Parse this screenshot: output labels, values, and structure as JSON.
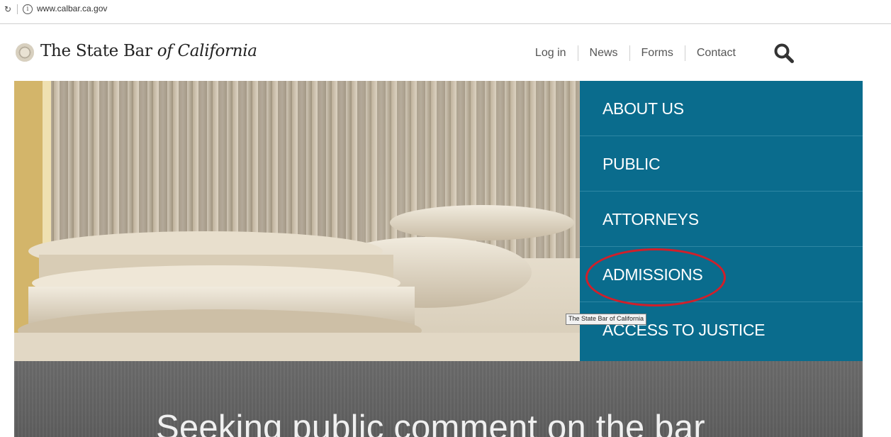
{
  "browser": {
    "reload_glyph": "↻",
    "info_glyph": "i",
    "url": "www.calbar.ca.gov"
  },
  "header": {
    "logo_text_main": "The State Bar ",
    "logo_text_italic": "of California",
    "nav": [
      "Log in",
      "News",
      "Forms",
      "Contact"
    ]
  },
  "side_nav": {
    "items": [
      "ABOUT US",
      "PUBLIC",
      "ATTORNEYS",
      "ADMISSIONS",
      "ACCESS TO JUSTICE"
    ]
  },
  "tooltip": "The State Bar of California",
  "banner": {
    "headline": "Seeking public comment on the bar"
  },
  "colors": {
    "nav_panel": "#0a6c8d",
    "annotation": "#d11f2a",
    "banner": "#636363"
  }
}
